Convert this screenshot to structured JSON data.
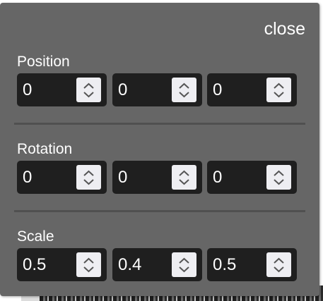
{
  "panel": {
    "close_label": "close"
  },
  "groups": [
    {
      "label": "Position",
      "values": [
        "0",
        "0",
        "0"
      ]
    },
    {
      "label": "Rotation",
      "values": [
        "0",
        "0",
        "0"
      ]
    },
    {
      "label": "Scale",
      "values": [
        "0.5",
        "0.4",
        "0.5"
      ]
    }
  ],
  "icons": {
    "spinner": "up-down-chevron-icon"
  },
  "colors": {
    "panel_bg": "#666666",
    "field_bg": "#1f1f1f",
    "spinner_bg": "#eeeef2",
    "text": "#ffffff",
    "divider": "#505050"
  }
}
